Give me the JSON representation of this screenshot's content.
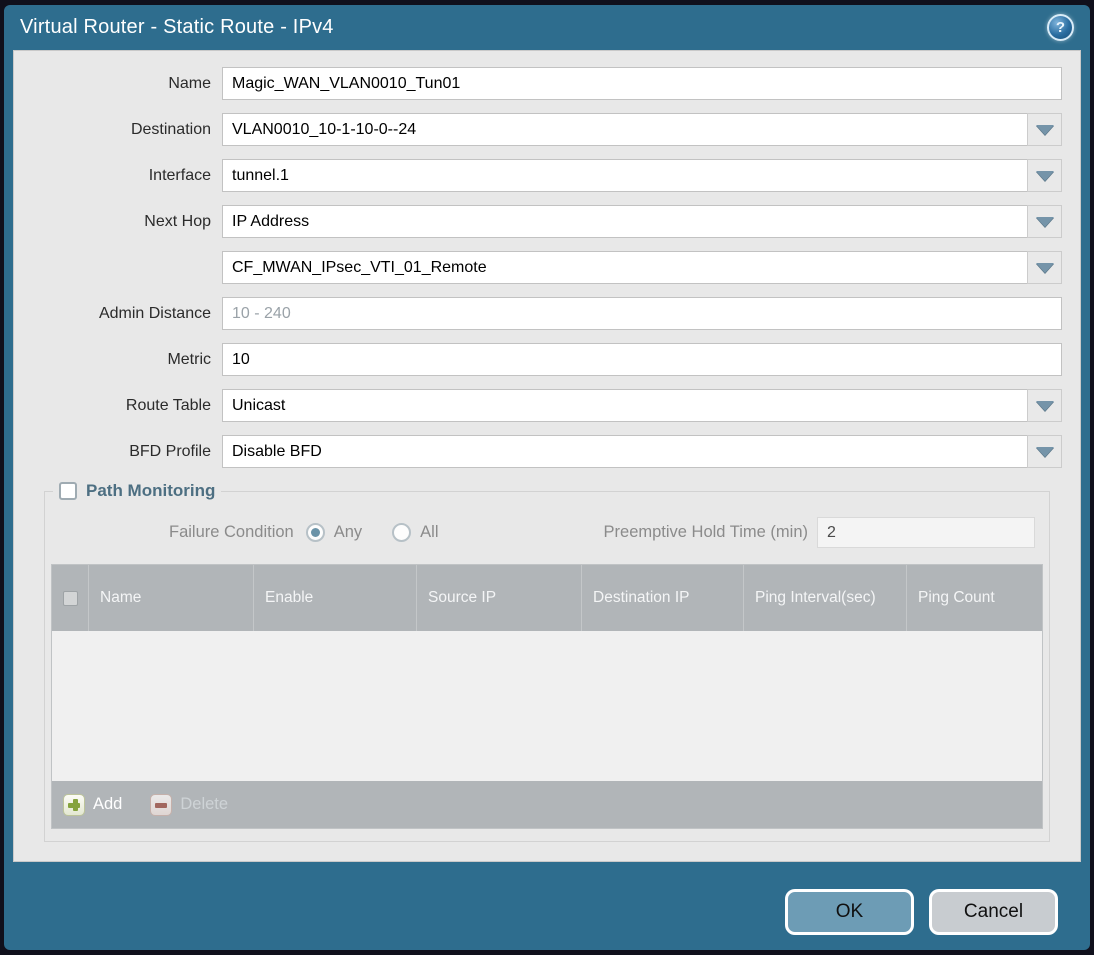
{
  "colors": {
    "titlebar_teal": "#2e6d8e",
    "content_gray": "#e8e8e8",
    "table_header_gray": "#b1b5b8",
    "ok_button": "#6d9cb5",
    "cancel_button": "#c8ccd0",
    "legend_text": "#4d6f82",
    "radio_selected_dot": "#6b93a8",
    "add_plus_green": "#85a33e",
    "delete_minus_red": "#a05a50",
    "dropdown_arrow": "#7594a9"
  },
  "window": {
    "title": "Virtual Router - Static Route - IPv4"
  },
  "icons": {
    "help_glyph": "?"
  },
  "form": {
    "fields": [
      {
        "label": "Name",
        "value": "Magic_WAN_VLAN0010_Tun01"
      },
      {
        "label": "Destination",
        "value": "VLAN0010_10-1-10-0--24"
      },
      {
        "label": "Interface",
        "value": "tunnel.1"
      },
      {
        "label": "Next Hop",
        "value": "IP Address"
      },
      {
        "label": "",
        "value": "CF_MWAN_IPsec_VTI_01_Remote"
      },
      {
        "label": "Admin Distance",
        "value": "",
        "placeholder": "10 - 240"
      },
      {
        "label": "Metric",
        "value": "10"
      },
      {
        "label": "Route Table",
        "value": "Unicast"
      },
      {
        "label": "BFD Profile",
        "value": "Disable BFD"
      }
    ]
  },
  "path_monitoring": {
    "legend": "Path Monitoring",
    "enabled": false,
    "failure_condition_label": "Failure Condition",
    "radio_any_label": "Any",
    "radio_all_label": "All",
    "selected_failure_condition": "Any",
    "preemptive_label": "Preemptive Hold Time (min)",
    "preemptive_value": "2",
    "table": {
      "columns": [
        "Name",
        "Enable",
        "Source IP",
        "Destination IP",
        "Ping Interval(sec)",
        "Ping Count"
      ],
      "rows": []
    },
    "add_label": "Add",
    "delete_label": "Delete"
  },
  "footer": {
    "ok_label": "OK",
    "cancel_label": "Cancel"
  }
}
